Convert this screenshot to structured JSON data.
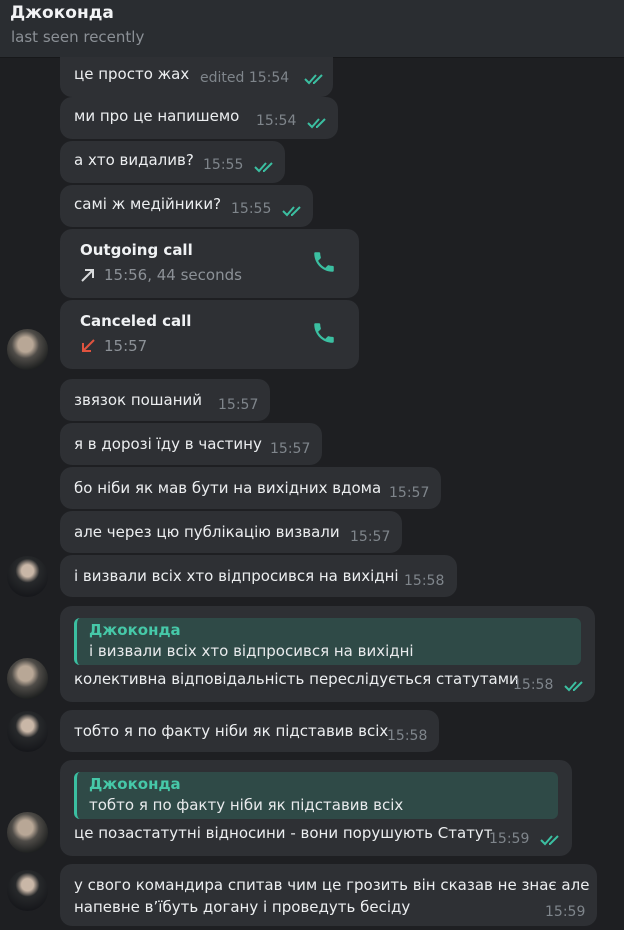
{
  "header": {
    "name": "Джоконда",
    "status": "last seen recently"
  },
  "messages": [
    {
      "text": "це просто жах",
      "time": "edited 15:54"
    },
    {
      "text": "ми про це напишемо",
      "time": "15:54"
    },
    {
      "text": "а хто видалив?",
      "time": "15:55"
    },
    {
      "text": "самі ж медійники?",
      "time": "15:55"
    },
    {
      "call_title": "Outgoing call",
      "call_sub": "15:56, 44 seconds",
      "icon": "phone-icon",
      "direction_icon": "outgoing-arrow-icon"
    },
    {
      "call_title": "Canceled call",
      "call_sub": "15:57",
      "icon": "phone-icon",
      "direction_icon": "missed-arrow-icon"
    },
    {
      "text": "звязок пошаний",
      "time": "15:57"
    },
    {
      "text": "я в дорозі їду в частину",
      "time": "15:57"
    },
    {
      "text": "бо ніби як мав бути на вихідних вдома",
      "time": "15:57"
    },
    {
      "text": "але через цю публікацію визвали",
      "time": "15:57"
    },
    {
      "text": "і визвали всіх хто відпросився на вихідні",
      "time": "15:58"
    },
    {
      "reply_name": "Джоконда",
      "reply_text": "і визвали всіх хто відпросився на вихідні",
      "text": "колективна відповідальність переслідується статутами",
      "time": "15:58"
    },
    {
      "text": "тобто я по факту ніби як підставив всіх",
      "time": "15:58"
    },
    {
      "reply_name": "Джоконда",
      "reply_text": "тобто я по факту ніби як підставив всіх",
      "text": "це позастатутні відносини - вони порушують Статут",
      "time": "15:59"
    },
    {
      "text_line1": "у свого командира спитав чим це грозить він сказав не знає але",
      "text_line2": "напевне в’їбуть догану і проведуть бесіду",
      "time": "15:59"
    }
  ],
  "colors": {
    "accent": "#3bbfa1",
    "bubble": "#2e3034",
    "background": "#1e1f22",
    "missed": "#e0533f"
  }
}
